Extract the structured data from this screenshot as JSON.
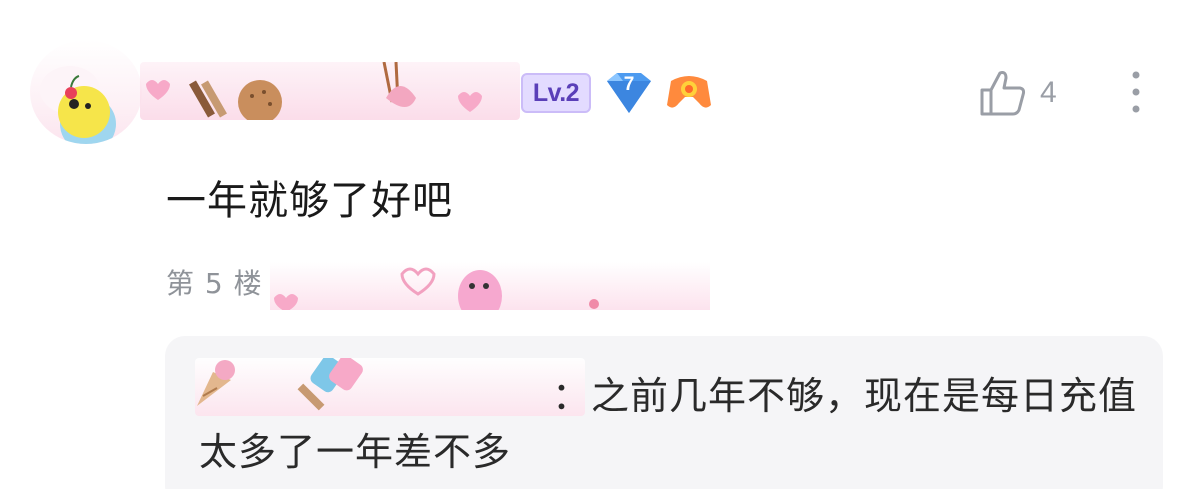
{
  "comment": {
    "level_badge": "Lv.2",
    "diamond_level": "7",
    "like_count": "4",
    "body": "一年就够了好吧",
    "floor": "第 5 楼"
  },
  "reply": {
    "separator": "：",
    "text_line1": "之前几年不够，现在是每日充值",
    "text_line2": "太多了一年差不多"
  },
  "colors": {
    "level_badge_bg": "#e3dbff",
    "level_badge_text": "#5a3fb8",
    "diamond": "#4d9bf0",
    "like_icon": "#9a9ea6",
    "reply_bg": "#f5f5f7"
  },
  "icons": [
    "avatar",
    "diamond-badge-icon",
    "game-badge-icon",
    "thumbs-up-icon",
    "more-vertical-icon"
  ]
}
